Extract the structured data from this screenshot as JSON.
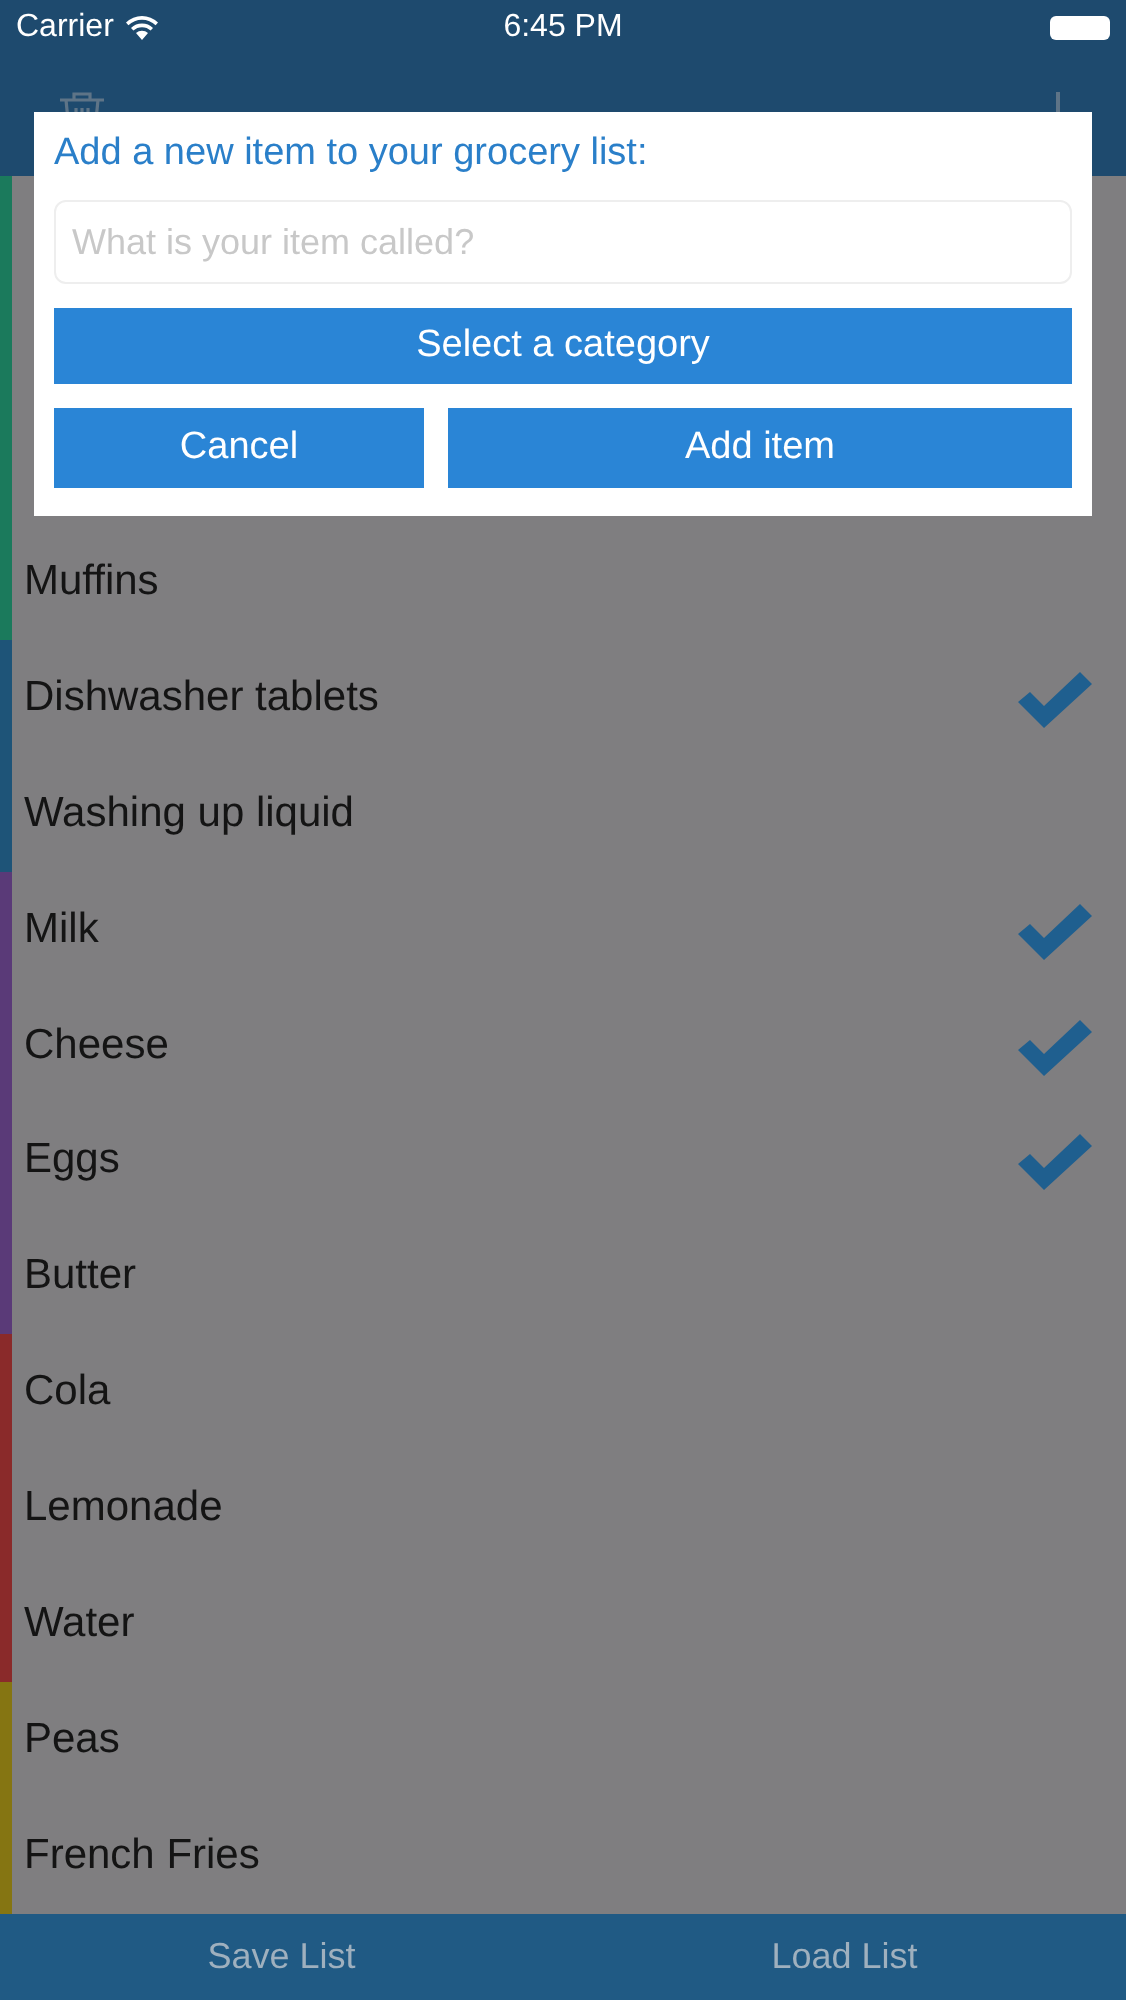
{
  "status_bar": {
    "carrier": "Carrier",
    "time": "6:45 PM"
  },
  "items": [
    {
      "color": "#1b7a5c"
    },
    {
      "color": "#1b7a5c"
    },
    {
      "color": "#1b7a5c"
    },
    {
      "name": "Muffins",
      "checked": false,
      "color": "#1b7a5c"
    },
    {
      "name": "Dishwasher tablets",
      "checked": true,
      "color": "#1e5478"
    },
    {
      "name": "Washing up liquid",
      "checked": false,
      "color": "#1e5478"
    },
    {
      "name": "Milk",
      "checked": true,
      "color": "#5a3a78"
    },
    {
      "name": "Cheese",
      "checked": true,
      "color": "#5a3a78"
    },
    {
      "name": "Eggs",
      "checked": true,
      "color": "#5a3a78"
    },
    {
      "name": "Butter",
      "checked": false,
      "color": "#5a3a78"
    },
    {
      "name": "Cola",
      "checked": false,
      "color": "#8a2a2a"
    },
    {
      "name": "Lemonade",
      "checked": false,
      "color": "#8a2a2a"
    },
    {
      "name": "Water",
      "checked": false,
      "color": "#8a2a2a"
    },
    {
      "name": "Peas",
      "checked": false,
      "color": "#857512"
    },
    {
      "name": "French Fries",
      "checked": false,
      "color": "#857512"
    }
  ],
  "bottom_bar": [
    "Save List",
    "Load List"
  ],
  "dialog": {
    "title": "Add a new item to your grocery list:",
    "placeholder": "What is your item called?",
    "category_button": "Select a category",
    "buttons": [
      "Cancel",
      "Add item"
    ]
  }
}
